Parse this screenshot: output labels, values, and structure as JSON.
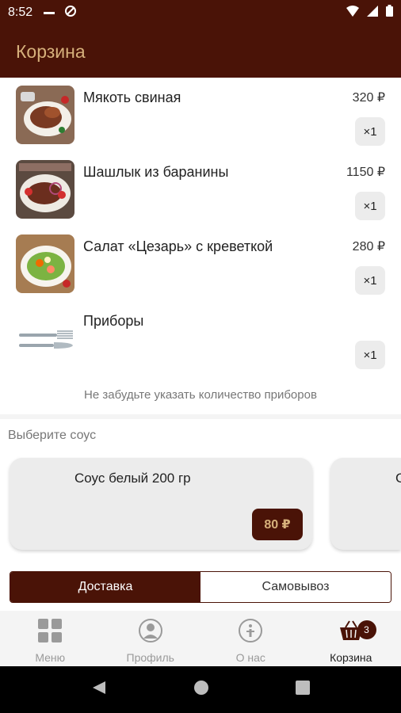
{
  "status_bar": {
    "time": "8:52"
  },
  "header": {
    "title": "Корзина"
  },
  "cart": {
    "items": [
      {
        "name": "Мякоть свиная",
        "price": "320 ₽",
        "qty": "×1"
      },
      {
        "name": "Шашлык из баранины",
        "price": "1150 ₽",
        "qty": "×1"
      },
      {
        "name": "Салат «Цезарь» с креветкой",
        "price": "280 ₽",
        "qty": "×1"
      },
      {
        "name": "Приборы",
        "price": "",
        "qty": "×1"
      }
    ],
    "reminder": "Не забудьте указать количество приборов"
  },
  "sauces": {
    "heading": "Выберите соус",
    "items": [
      {
        "name": "Соус белый 200 гр",
        "price": "80 ₽"
      },
      {
        "name": "С",
        "price": ""
      }
    ]
  },
  "delivery_toggle": {
    "active": "Доставка",
    "inactive": "Самовывоз"
  },
  "bottom_nav": {
    "items": [
      {
        "label": "Меню",
        "icon": "grid-icon"
      },
      {
        "label": "Профиль",
        "icon": "user-icon"
      },
      {
        "label": "О нас",
        "icon": "info-icon"
      },
      {
        "label": "Корзина",
        "icon": "basket-icon"
      }
    ],
    "cart_badge": "3"
  },
  "colors": {
    "brand": "#4a1307",
    "accent_text": "#d6b07b",
    "muted": "#9a9a9a"
  }
}
